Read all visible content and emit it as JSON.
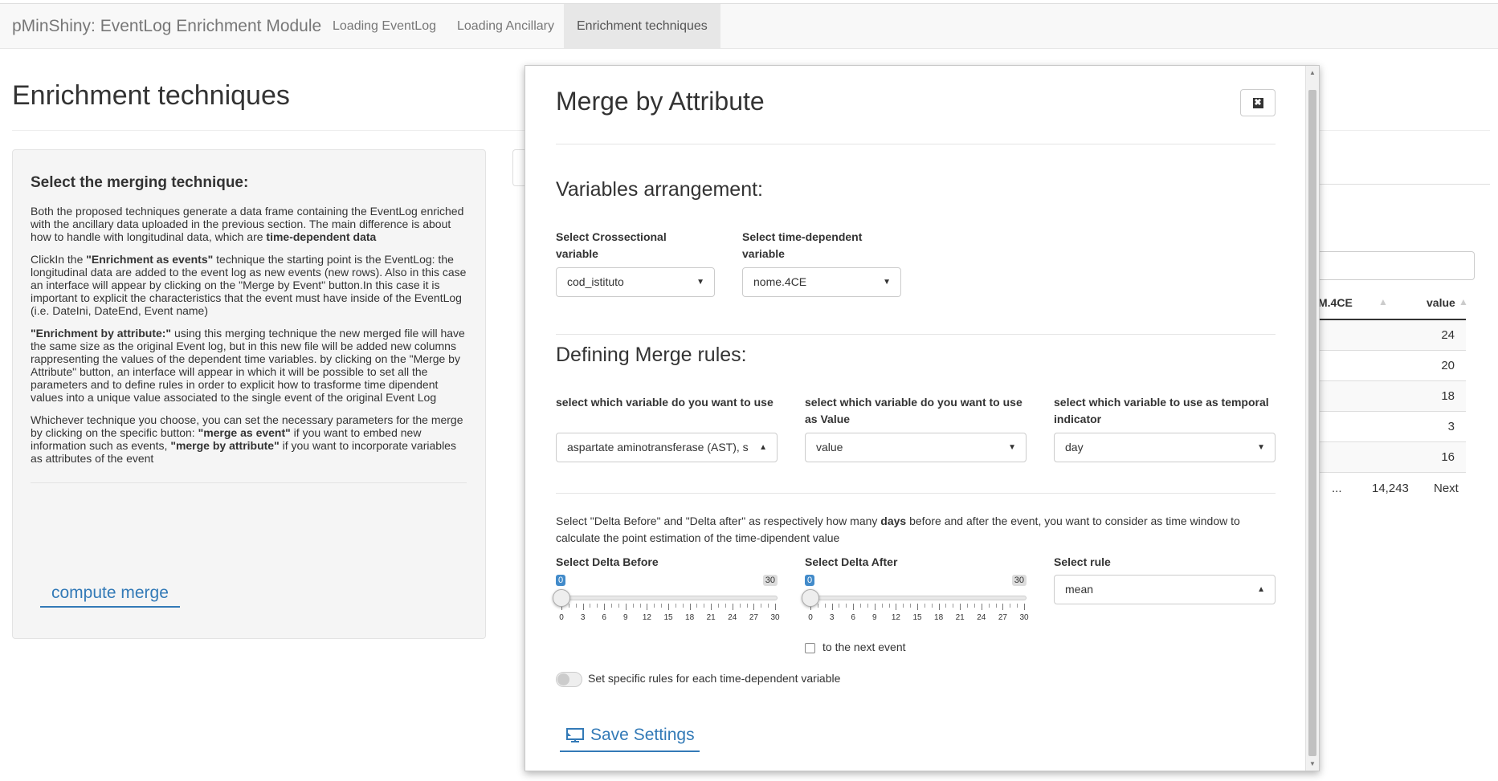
{
  "app": {
    "brand": "pMinShiny: EventLog Enrichment Module",
    "nav": [
      {
        "label": "Loading EventLog"
      },
      {
        "label": "Loading Ancillary"
      },
      {
        "label": "Enrichment techniques",
        "active": true
      }
    ]
  },
  "page": {
    "title": "Enrichment techniques"
  },
  "sidebar": {
    "heading": "Select the merging technique:",
    "compute_label": "compute merge"
  },
  "background_table": {
    "headers": [
      "M.4CE",
      "value"
    ],
    "values": [
      "24",
      "20",
      "18",
      "3",
      "16"
    ],
    "pager": {
      "ellipsis": "...",
      "last_page": "14,243",
      "next": "Next"
    }
  },
  "modal": {
    "title": "Merge by Attribute",
    "section1_title": "Variables arrangement:",
    "crossectional_label": "Select Crossectional variable",
    "crossectional_value": "cod_istituto",
    "timedep_label": "Select time-dependent variable",
    "timedep_value": "nome.4CE",
    "section2_title": "Defining Merge rules:",
    "var_use_label": "select which variable do you want to use",
    "var_use_value": "aspartate aminotransferase (AST), s",
    "var_value_label": "select which variable do you want to use as Value",
    "var_value_value": "value",
    "var_temporal_label": "select which variable to use as temporal indicator",
    "var_temporal_value": "day",
    "delta_help_pre": "Select \"Delta Before\" and \"Delta after\" as respectively how many ",
    "delta_help_bold": "days",
    "delta_help_post": " before and after the event, you want to consider as time window to calculate the point estimation of the time-dipendent value",
    "delta_before_label": "Select Delta Before",
    "delta_after_label": "Select Delta After",
    "slider_min": "0",
    "slider_max": "30",
    "delta_before_value": 0,
    "delta_after_value": 0,
    "slider_ticks": [
      "0",
      "3",
      "6",
      "9",
      "12",
      "15",
      "18",
      "21",
      "24",
      "27",
      "30"
    ],
    "rule_label": "Select rule",
    "rule_value": "mean",
    "next_event_label": "to the next event",
    "specific_rules_label": "Set specific rules for each time-dependent variable",
    "save_label": "Save Settings"
  },
  "colors": {
    "accent": "#337ab7",
    "slider_badge": "#428bca",
    "navbar_bg": "#f8f8f8",
    "well_bg": "#f5f5f5"
  },
  "icons": {
    "close": "close-icon",
    "save": "save-settings-icon",
    "caret": "caret-icon"
  }
}
